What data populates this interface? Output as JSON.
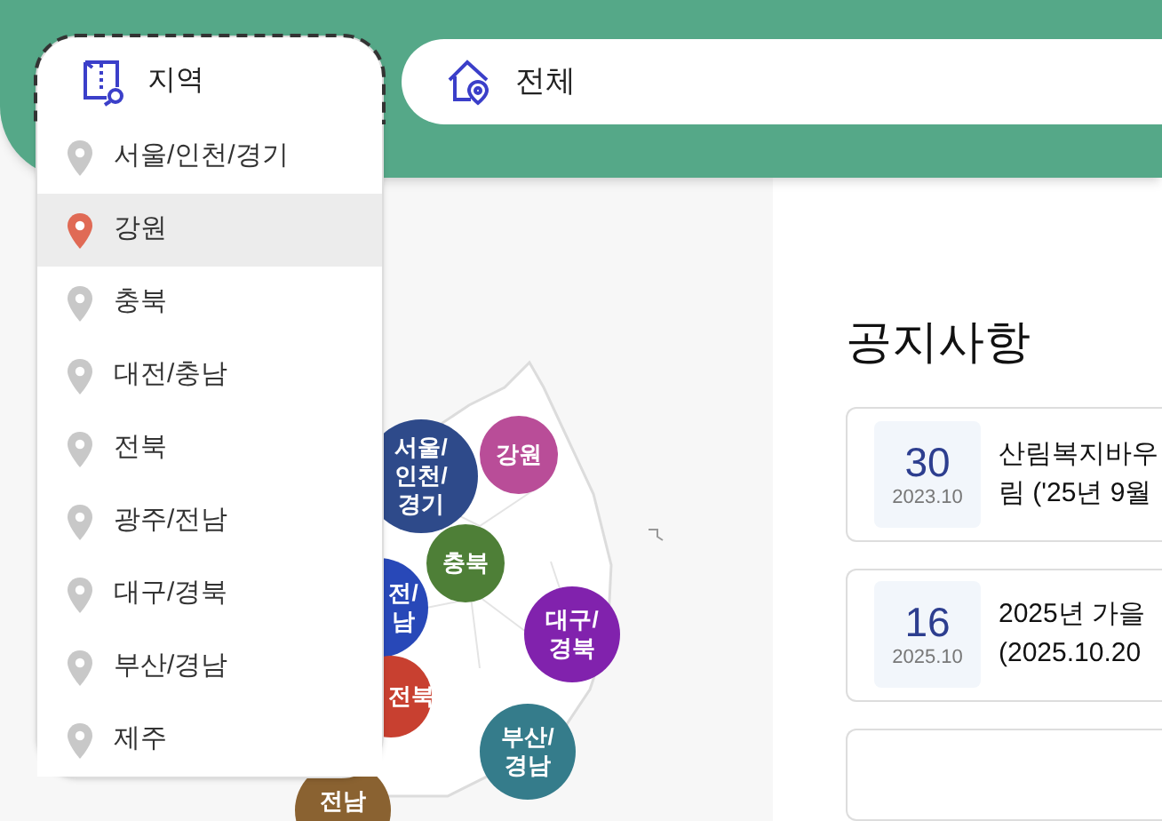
{
  "region_select": {
    "label": "지역",
    "options": [
      {
        "label": "서울/인천/경기",
        "selected": false
      },
      {
        "label": "강원",
        "selected": true
      },
      {
        "label": "충북",
        "selected": false
      },
      {
        "label": "대전/충남",
        "selected": false
      },
      {
        "label": "전북",
        "selected": false
      },
      {
        "label": "광주/전남",
        "selected": false
      },
      {
        "label": "대구/경북",
        "selected": false
      },
      {
        "label": "부산/경남",
        "selected": false
      },
      {
        "label": "제주",
        "selected": false
      }
    ]
  },
  "place_select": {
    "value": "전체"
  },
  "map": {
    "regions": [
      {
        "lines": [
          "서울/",
          "인천/",
          "경기"
        ],
        "color": "#2e4a8a"
      },
      {
        "lines": [
          "강원"
        ],
        "color": "#b94d98"
      },
      {
        "lines": [
          "충북"
        ],
        "color": "#4e7f37"
      },
      {
        "lines": [
          "전/",
          "남"
        ],
        "color": "#2848b8"
      },
      {
        "lines": [
          "대구/",
          "경북"
        ],
        "color": "#8122ad"
      },
      {
        "lines": [
          "전북"
        ],
        "color": "#c84030"
      },
      {
        "lines": [
          "부산/",
          "경남"
        ],
        "color": "#357c8b"
      },
      {
        "lines": [
          "전남"
        ],
        "color": "#8a6231"
      }
    ]
  },
  "notices": {
    "title": "공지사항",
    "items": [
      {
        "day": "30",
        "month": "2023.10",
        "lines": [
          "산림복지바우",
          "림 ('25년 9월"
        ]
      },
      {
        "day": "16",
        "month": "2025.10",
        "lines": [
          "2025년 가을",
          "(2025.10.20"
        ]
      }
    ]
  }
}
